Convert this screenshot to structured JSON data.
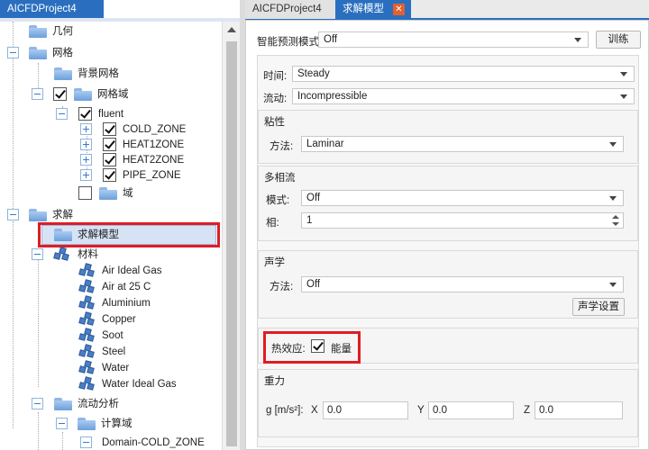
{
  "left_panel": {
    "tab_title": "AICFDProject4",
    "tree": {
      "geometry": "几何",
      "mesh": "网格",
      "background_mesh": "背景网格",
      "mesh_domain": "网格域",
      "fluent": "fluent",
      "zones": [
        "COLD_ZONE",
        "HEAT1ZONE",
        "HEAT2ZONE",
        "PIPE_ZONE"
      ],
      "domain": "域",
      "solve": "求解",
      "solver_model": "求解模型",
      "materials": "材料",
      "material_items": [
        "Air Ideal Gas",
        "Air at 25 C",
        "Aluminium",
        "Copper",
        "Soot",
        "Steel",
        "Water",
        "Water Ideal Gas"
      ],
      "flow_analysis": "流动分析",
      "compute_domain": "计算域",
      "domain_cold_zone": "Domain-COLD_ZONE"
    }
  },
  "tabs": [
    "AICFDProject4",
    "求解模型"
  ],
  "tab_close": "✕",
  "form": {
    "smart_label": "智能预测模式:",
    "smart_value": "Off",
    "train_button": "训练",
    "time_label": "时间:",
    "time_value": "Steady",
    "flow_label": "流动:",
    "flow_value": "Incompressible",
    "viscosity": {
      "title": "粘性",
      "method_label": "方法:",
      "method_value": "Laminar"
    },
    "multiphase": {
      "title": "多相流",
      "mode_label": "模式:",
      "mode_value": "Off",
      "phase_label": "相:",
      "phase_value": "1"
    },
    "acoustics": {
      "title": "声学",
      "method_label": "方法:",
      "method_value": "Off",
      "settings_button": "声学设置"
    },
    "thermal": {
      "label": "热效应:",
      "energy_checked": true,
      "energy_label": "能量"
    },
    "gravity": {
      "title": "重力",
      "label": "g [m/s²]:",
      "x_label": "X",
      "x_value": "0.0",
      "y_label": "Y",
      "y_value": "0.0",
      "z_label": "Z",
      "z_value": "0.0"
    }
  },
  "colors": {
    "accent": "#2a6fbf",
    "highlight_box": "#e01c23",
    "tab_close": "#e3602f"
  }
}
